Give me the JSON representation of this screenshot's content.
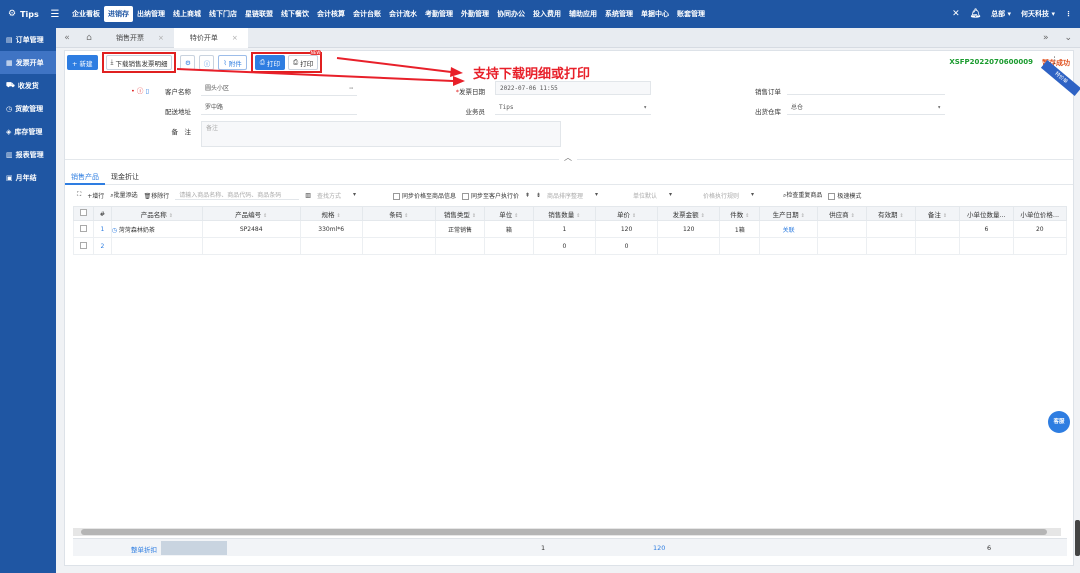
{
  "topbar": {
    "logo": "Tips",
    "nav": [
      "企业看板",
      "进销存",
      "出纳管理",
      "线上商城",
      "线下门店",
      "星链联盟",
      "线下餐饮",
      "会计核算",
      "会计台账",
      "会计流水",
      "考勤管理",
      "外勤管理",
      "协同办公",
      "投入费用",
      "辅助应用",
      "系统管理",
      "单据中心",
      "账套管理"
    ],
    "active_nav": "进销存",
    "user": "总部",
    "company": "何天科技"
  },
  "sidebar": {
    "items": [
      "订单管理",
      "发票开单",
      "收发货",
      "货款管理",
      "库存管理",
      "报表管理",
      "月年结"
    ],
    "active": "发票开单"
  },
  "tabs": {
    "items": [
      "销售开票",
      "特价开单"
    ],
    "active": "特价开单"
  },
  "toolbar": {
    "new_label": "+ 新建",
    "download_label": "下载销售发票明细",
    "attach_label": "附件",
    "print_label": "打印",
    "print2_label": "打印",
    "new_badge": "NEW",
    "order_no": "XSFP2022070600009",
    "save_status": "暂存成功",
    "ribbon": "特价单"
  },
  "annotation": {
    "text": "支持下载明细或打印",
    "color": "#e8202a"
  },
  "form": {
    "customer_label": "客户名称",
    "customer_value": "圆头小区",
    "address_label": "配送地址",
    "address_value": "罗中路",
    "remark_label": "备　注",
    "remark_value": "备注",
    "date_label": "发票日期",
    "date_value": "2022-07-06 11:55",
    "salesman_label": "业务员",
    "salesman_value": "Tips",
    "sales_order_label": "销售订单",
    "sales_order_value": "",
    "warehouse_label": "出货仓库",
    "warehouse_value": "总仓"
  },
  "subtabs": {
    "items": [
      "销售产品",
      "现金折让"
    ],
    "active": "销售产品"
  },
  "gridbar": {
    "add_row": "+增行",
    "batch_add": "批量添选",
    "delete_row": "移除行",
    "search_placeholder": "请输入商品名称、商品代码、商品条码",
    "search_mode": "查找方式",
    "sync_price": "同步价格至商品信息",
    "sync_customer": "同步至客户执行价",
    "sort_placeholder": "商品排序整理",
    "unit_default": "单位默认",
    "price_rule": "价格执行规则",
    "check_dup": "检查重复商品",
    "fast_mode": "极速模式"
  },
  "grid": {
    "columns": [
      "#",
      "产品名称",
      "产品编号",
      "规格",
      "条码",
      "销售类型",
      "单位",
      "销售数量",
      "单价",
      "发票金额",
      "件数",
      "生产日期",
      "供应商",
      "有效期",
      "备注",
      "小单位数量...",
      "小单位价格..."
    ],
    "rows": [
      [
        "1",
        "菏菏森林奶茶",
        "SP2484",
        "330ml*6",
        "",
        "正常销售",
        "箱",
        "1",
        "120",
        "120",
        "1箱",
        "关联",
        "",
        "",
        "",
        "6",
        "20"
      ],
      [
        "2",
        "",
        "",
        "",
        "",
        "",
        "",
        "0",
        "0",
        "",
        "",
        "",
        "",
        "",
        "",
        "",
        ""
      ]
    ]
  },
  "footer": {
    "label": "整单折扣",
    "qty_total": "1",
    "amount_total": "120",
    "small_qty_total": "6"
  },
  "service_label": "客服"
}
